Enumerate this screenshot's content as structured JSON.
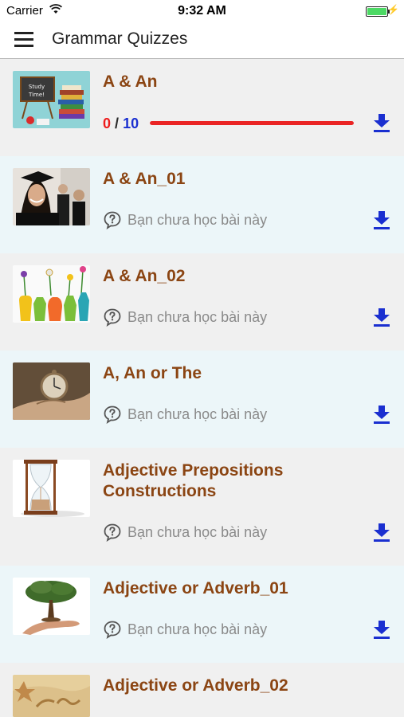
{
  "status_bar": {
    "carrier": "Carrier",
    "time": "9:32 AM"
  },
  "nav": {
    "title": "Grammar Quizzes",
    "menu_icon": "hamburger-menu-icon"
  },
  "colors": {
    "title": "#8b4513",
    "score_done": "#ee1c1c",
    "score_total": "#1a2fd0",
    "progress": "#ea2424",
    "download": "#1a2fd0"
  },
  "lessons": [
    {
      "title": "A & An",
      "score": "0",
      "separator": "/",
      "total": "10",
      "progress": 1.0,
      "download_icon": "download-icon"
    },
    {
      "title": "A & An_01",
      "status": "Bạn chưa học bài này",
      "download_icon": "download-icon"
    },
    {
      "title": "A & An_02",
      "status": "Bạn chưa học bài này",
      "download_icon": "download-icon"
    },
    {
      "title": "A, An or The",
      "status": "Bạn chưa học bài này",
      "download_icon": "download-icon"
    },
    {
      "title": "Adjective Prepositions Constructions",
      "status": "Bạn chưa học bài này",
      "download_icon": "download-icon"
    },
    {
      "title": "Adjective or Adverb_01",
      "status": "Bạn chưa học bài này",
      "download_icon": "download-icon"
    },
    {
      "title": "Adjective or Adverb_02"
    }
  ]
}
